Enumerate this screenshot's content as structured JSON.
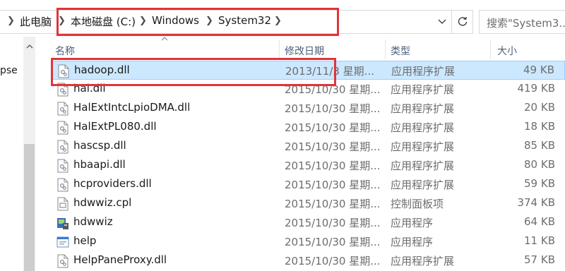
{
  "address_bar": {
    "breadcrumbs": [
      "此电脑",
      "本地磁盘 (C:)",
      "Windows",
      "System32"
    ]
  },
  "search": {
    "placeholder": "搜索\"System3..."
  },
  "nav_pane": {
    "partial_label": "pse"
  },
  "columns": {
    "name": "名称",
    "date": "修改日期",
    "type": "类型",
    "size": "大小"
  },
  "files": [
    {
      "name": "hadoop.dll",
      "date": "2013/11/3 星期...",
      "type": "应用程序扩展",
      "size": "49 KB",
      "icon": "dll-file-icon",
      "selected": true
    },
    {
      "name": "hal.dll",
      "date": "2015/10/30 星期...",
      "type": "应用程序扩展",
      "size": "419 KB",
      "icon": "dll-file-icon"
    },
    {
      "name": "HalExtIntcLpioDMA.dll",
      "date": "2015/10/30 星期...",
      "type": "应用程序扩展",
      "size": "20 KB",
      "icon": "dll-file-icon"
    },
    {
      "name": "HalExtPL080.dll",
      "date": "2015/10/30 星期...",
      "type": "应用程序扩展",
      "size": "18 KB",
      "icon": "dll-file-icon"
    },
    {
      "name": "hascsp.dll",
      "date": "2015/10/30 星期...",
      "type": "应用程序扩展",
      "size": "85 KB",
      "icon": "dll-file-icon"
    },
    {
      "name": "hbaapi.dll",
      "date": "2015/10/30 星期...",
      "type": "应用程序扩展",
      "size": "80 KB",
      "icon": "dll-file-icon"
    },
    {
      "name": "hcproviders.dll",
      "date": "2015/10/30 星期...",
      "type": "应用程序扩展",
      "size": "59 KB",
      "icon": "dll-file-icon"
    },
    {
      "name": "hdwwiz.cpl",
      "date": "2015/10/30 星期...",
      "type": "控制面板项",
      "size": "374 KB",
      "icon": "cpl-file-icon"
    },
    {
      "name": "hdwwiz",
      "date": "2015/10/30 星期...",
      "type": "应用程序",
      "size": "64 KB",
      "icon": "hardware-wizard-icon"
    },
    {
      "name": "help",
      "date": "2015/10/30 星期...",
      "type": "应用程序",
      "size": "11 KB",
      "icon": "app-window-icon"
    },
    {
      "name": "HelpPaneProxy.dll",
      "date": "2015/10/30 星期...",
      "type": "应用程序扩展",
      "size": "57 KB",
      "icon": "dll-file-icon"
    }
  ],
  "colors": {
    "selection_bg": "#cce8ff",
    "selection_border": "#99d1ff",
    "highlight_frame": "#e0353a",
    "header_text": "#4c607a"
  }
}
